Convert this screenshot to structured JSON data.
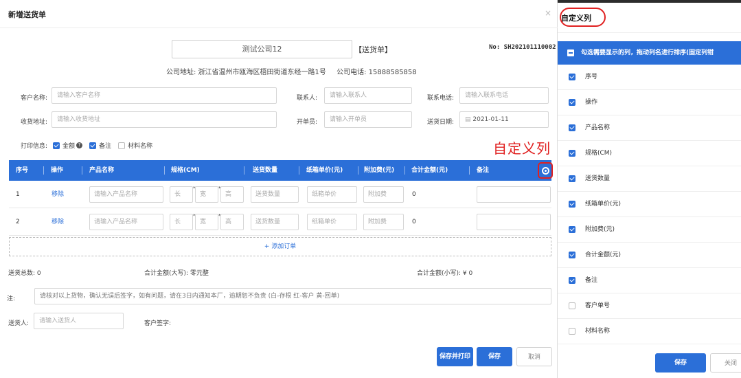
{
  "modal": {
    "title": "新增送货单",
    "close": "×",
    "company_name": "测试公司12",
    "doc_type": "【送货单】",
    "doc_no": "No: SH202101110002",
    "address": "公司地址: 浙江省温州市瓯海区梧田街道东经一路1号",
    "phone": "公司电话: 15888585858"
  },
  "form": {
    "customer_label": "客户名称:",
    "customer_placeholder": "请输入客户名称",
    "contact_label": "联系人:",
    "contact_placeholder": "请输入联系人",
    "contact_phone_label": "联系电话:",
    "contact_phone_placeholder": "请输入联系电话",
    "address_label": "收货地址:",
    "address_placeholder": "请输入收货地址",
    "issuer_label": "开单员:",
    "issuer_placeholder": "请输入开单员",
    "date_label": "送货日期:",
    "date_value": "2021-01-11",
    "print_label": "打印信息:",
    "print_options": [
      {
        "label": "金额",
        "checked": true
      },
      {
        "label": "备注",
        "checked": true
      },
      {
        "label": "材料名称",
        "checked": false
      }
    ]
  },
  "annotation": "自定义列",
  "table": {
    "headers": [
      "序号",
      "操作",
      "产品名称",
      "规格(CM)",
      "送货数量",
      "纸箱单价(元)",
      "附加费(元)",
      "合计金额(元)",
      "备注"
    ],
    "rows": [
      {
        "index": "1",
        "action": "移除",
        "product_ph": "请输入产品名称",
        "len_ph": "长",
        "wid_ph": "宽",
        "hei_ph": "高",
        "qty_ph": "送货数量",
        "price_ph": "纸箱单价",
        "fee_ph": "附加费",
        "total": "0"
      },
      {
        "index": "2",
        "action": "移除",
        "product_ph": "请输入产品名称",
        "len_ph": "长",
        "wid_ph": "宽",
        "hei_ph": "高",
        "qty_ph": "送货数量",
        "price_ph": "纸箱单价",
        "fee_ph": "附加费",
        "total": "0"
      }
    ],
    "add_order": "+ 添加订单"
  },
  "summary": {
    "total_qty": "送货总数:  0",
    "amount_upper": "合计金额(大写):   零元整",
    "amount_lower": "合计金额(小写):   ¥ 0"
  },
  "remark": {
    "label": "注:",
    "text": "请核对以上货物，确认无误后签字，如有问题，请在3日内通知本厂，逾期恕不负责 (白-存根 红-客户 黄-回单)"
  },
  "sender": {
    "label": "送货人:",
    "placeholder": "请输入送货人",
    "signature_label": "客户签字:"
  },
  "buttons": {
    "save_print": "保存并打印",
    "save": "保存",
    "cancel": "取消"
  },
  "panel": {
    "title": "自定义列",
    "banner": "勾选需要显示的列，拖动列名进行排序(固定列钳",
    "columns": [
      {
        "label": "序号",
        "checked": true
      },
      {
        "label": "操作",
        "checked": true
      },
      {
        "label": "产品名称",
        "checked": true
      },
      {
        "label": "规格(CM)",
        "checked": true
      },
      {
        "label": "送货数量",
        "checked": true
      },
      {
        "label": "纸箱单价(元)",
        "checked": true
      },
      {
        "label": "附加费(元)",
        "checked": true
      },
      {
        "label": "合计金额(元)",
        "checked": true
      },
      {
        "label": "备注",
        "checked": true
      },
      {
        "label": "客户单号",
        "checked": false
      },
      {
        "label": "材料名称",
        "checked": false
      }
    ],
    "save": "保存",
    "close": "关闭"
  },
  "colors": {
    "primary": "#2b6fd8",
    "annotation_red": "#e02020"
  }
}
